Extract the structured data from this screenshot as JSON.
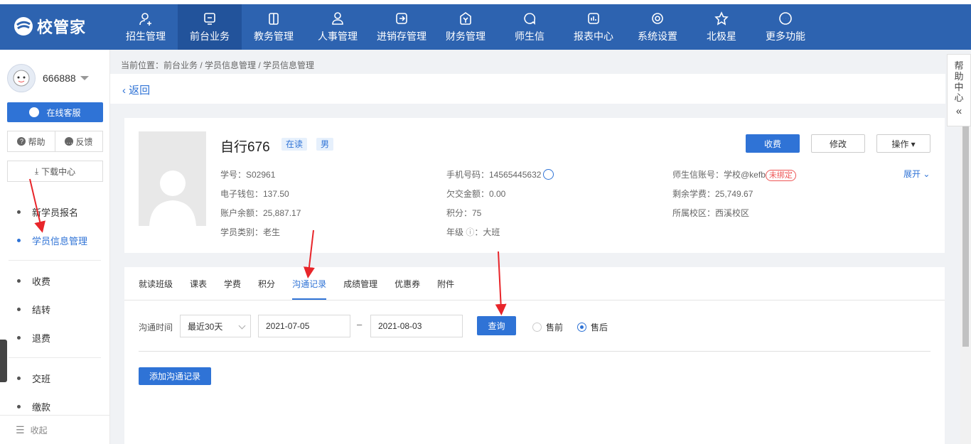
{
  "app": {
    "logo_text": "校管家"
  },
  "nav": [
    {
      "label": "招生管理",
      "icon": "user-add-icon"
    },
    {
      "label": "前台业务",
      "icon": "monitor-icon",
      "active": true
    },
    {
      "label": "教务管理",
      "icon": "book-icon"
    },
    {
      "label": "人事管理",
      "icon": "person-icon"
    },
    {
      "label": "进销存管理",
      "icon": "inventory-icon"
    },
    {
      "label": "财务管理",
      "icon": "money-icon"
    },
    {
      "label": "师生信",
      "icon": "chat-icon"
    },
    {
      "label": "报表中心",
      "icon": "report-icon"
    },
    {
      "label": "系统设置",
      "icon": "settings-icon"
    },
    {
      "label": "北极星",
      "icon": "star-icon"
    },
    {
      "label": "更多功能",
      "icon": "more-icon"
    }
  ],
  "sidebar": {
    "username": "666888",
    "service_label": "在线客服",
    "help_label": "帮助",
    "feedback_label": "反馈",
    "download_label": "下载中心",
    "menu": [
      "新学员报名",
      "学员信息管理",
      "收费",
      "结转",
      "退费",
      "交班",
      "缴款"
    ],
    "collapse_label": "收起"
  },
  "breadcrumb": "当前位置：前台业务 / 学员信息管理 / 学员信息管理",
  "back_label": "返回",
  "student": {
    "name": "自行676",
    "status_tag": "在读",
    "gender_tag": "男",
    "student_no": "学号：S02961",
    "wallet": "电子钱包：137.50",
    "balance": "账户余额：25,887.17",
    "category": "学员类别：老生",
    "phone": "手机号码：14565445632",
    "owed": "欠交金额：0.00",
    "points": "积分：75",
    "grade": "年级",
    "grade_value": "：大班",
    "account_label": "师生信账号：学校@kefb",
    "account_badge": "未绑定",
    "remaining": "剩余学费：25,749.67",
    "campus": "所属校区：西溪校区"
  },
  "actions": {
    "charge": "收费",
    "edit": "修改",
    "operate": "操作 ▾",
    "expand": "展开"
  },
  "tabs": [
    "就读班级",
    "课表",
    "学费",
    "积分",
    "沟通记录",
    "成绩管理",
    "优惠券",
    "附件"
  ],
  "active_tab": "沟通记录",
  "filter": {
    "label": "沟通时间",
    "range": "最近30天",
    "start": "2021-07-05",
    "end": "2021-08-03",
    "dash": "–",
    "query": "查询",
    "radio_pre": "售前",
    "radio_post": "售后"
  },
  "add_record_label": "添加沟通记录",
  "help_center": [
    "帮",
    "助",
    "中",
    "心"
  ],
  "colors": {
    "primary": "#2f73d6",
    "nav_bg": "#2d63b0",
    "arrow": "#e8252a"
  }
}
